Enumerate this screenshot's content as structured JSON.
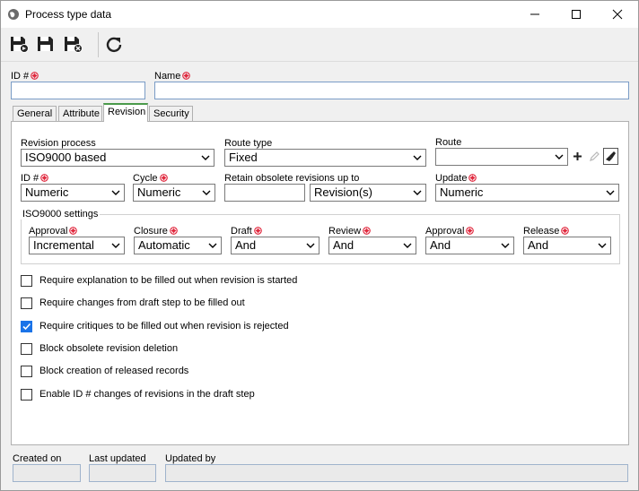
{
  "window": {
    "title": "Process type data"
  },
  "fields": {
    "id_label": "ID #",
    "name_label": "Name",
    "id_value": "",
    "name_value": ""
  },
  "tabs": [
    {
      "label": "General"
    },
    {
      "label": "Attribute"
    },
    {
      "label": "Revision"
    },
    {
      "label": "Security"
    }
  ],
  "revision": {
    "revision_process_label": "Revision process",
    "revision_process_value": "ISO9000 based",
    "route_type_label": "Route type",
    "route_type_value": "Fixed",
    "route_label": "Route",
    "route_value": "",
    "id_label": "ID #",
    "id_value": "Numeric",
    "cycle_label": "Cycle",
    "cycle_value": "Numeric",
    "retain_label": "Retain obsolete revisions up to",
    "retain_value": "",
    "retain_unit": "Revision(s)",
    "update_label": "Update",
    "update_value": "Numeric"
  },
  "iso": {
    "title": "ISO9000 settings",
    "approval1_label": "Approval",
    "approval1_value": "Incremental",
    "closure_label": "Closure",
    "closure_value": "Automatic",
    "draft_label": "Draft",
    "draft_value": "And",
    "review_label": "Review",
    "review_value": "And",
    "approval2_label": "Approval",
    "approval2_value": "And",
    "release_label": "Release",
    "release_value": "And"
  },
  "checkboxes": [
    {
      "label": "Require explanation to be filled out when revision is started",
      "checked": false
    },
    {
      "label": "Require changes from draft step to be filled out",
      "checked": false
    },
    {
      "label": "Require critiques to be filled out when revision is rejected",
      "checked": true
    },
    {
      "label": "Block obsolete revision deletion",
      "checked": false
    },
    {
      "label": "Block creation of released records",
      "checked": false
    },
    {
      "label": "Enable ID # changes of revisions in the draft step",
      "checked": false
    }
  ],
  "footer": {
    "created_on_label": "Created on",
    "last_updated_label": "Last updated",
    "updated_by_label": "Updated by",
    "created_on_value": "",
    "last_updated_value": "",
    "updated_by_value": ""
  },
  "colors": {
    "required": "#e0243a",
    "checkbox_checked": "#1a73e8",
    "active_tab_accent": "#4a9a4a",
    "input_border": "#7a9cc6"
  }
}
